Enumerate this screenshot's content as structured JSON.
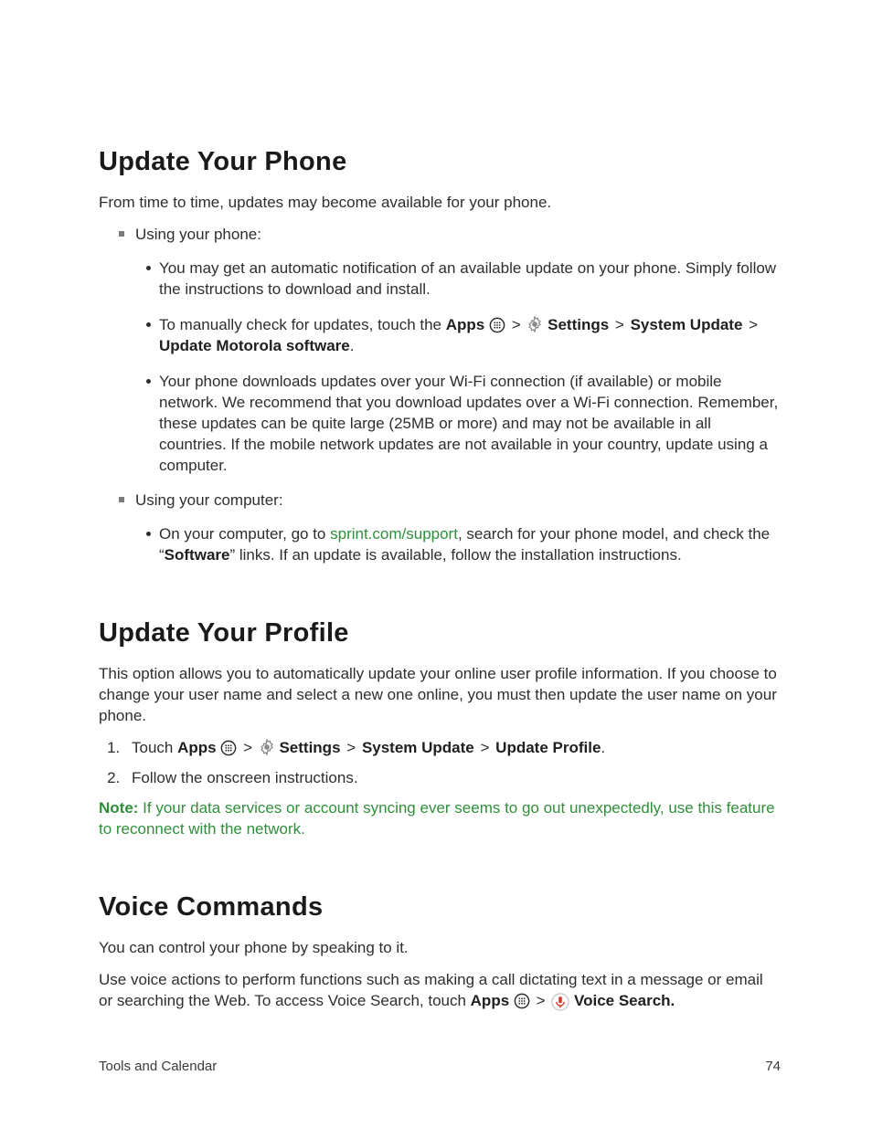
{
  "sections": {
    "s1": {
      "heading": "Update Your Phone",
      "intro": "From time to time, updates may become available for your phone.",
      "b1": "Using your phone:",
      "b1a": "You may get an automatic notification of an available update on your phone. Simply follow the instructions to download and install.",
      "b1b_pre": "To manually check for updates, touch the ",
      "b1b_apps": "Apps",
      "b1b_settings": " Settings",
      "b1b_sysupd": "System Update",
      "b1b_updmoto": "Update Motorola software",
      "b1c": "Your phone downloads updates over your Wi-Fi connection (if available) or mobile network. We recommend that you download updates over a Wi-Fi connection. Remember, these updates can be quite large (25MB or more) and may not be available in all countries. If the mobile network updates are not available in your country, update using a computer.",
      "b2": "Using your computer:",
      "b2a_pre": "On your computer, go to ",
      "b2a_link": "sprint.com/support",
      "b2a_post1": ", search for your phone model, and check the “",
      "b2a_sw": "Software",
      "b2a_post2": "” links. If an update is available, follow the installation instructions."
    },
    "s2": {
      "heading": "Update Your Profile",
      "intro": "This option allows you to automatically update your online user profile information. If you choose to change your user name and select a new one online, you must then update the user name on your phone.",
      "step1_pre": "Touch ",
      "step1_apps": "Apps",
      "step1_settings": " Settings",
      "step1_sysupd": "System Update",
      "step1_updprof": "Update Profile",
      "step2": "Follow the onscreen instructions.",
      "note_label": "Note:",
      "note_body": " If your data services or account syncing ever seems to go out unexpectedly, use this feature to reconnect with the network."
    },
    "s3": {
      "heading": "Voice Commands",
      "p1": "You can control your phone by speaking to it.",
      "p2a": "Use voice actions to perform functions such as making a call dictating text in a message or email or searching the Web. To access Voice Search, touch ",
      "p2_apps": "Apps",
      "p2_vs": " Voice Search."
    }
  },
  "gt": ">",
  "period": ".",
  "footer": {
    "left": "Tools and Calendar",
    "right": "74"
  }
}
